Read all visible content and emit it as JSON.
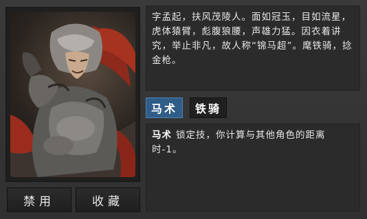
{
  "buttons": {
    "ban": "禁用",
    "favorite": "收藏"
  },
  "description": "字孟起，扶风茂陵人。面如冠玉，目如流星，虎体猿臂，彪腹狼腰，声雄力猛。因衣着讲究，举止非凡，故人称“锦马超”。麾铁骑，捻金枪。",
  "skills": {
    "tabs": [
      {
        "label": "马术",
        "active": true
      },
      {
        "label": "铁骑",
        "active": false
      }
    ],
    "selected": {
      "name": "马术",
      "text": "锁定技，你计算与其他角色的距离时-1。"
    }
  },
  "colors": {
    "active_tab": "#2f5d87",
    "inactive_tab": "#202020",
    "panel": "#343434"
  }
}
